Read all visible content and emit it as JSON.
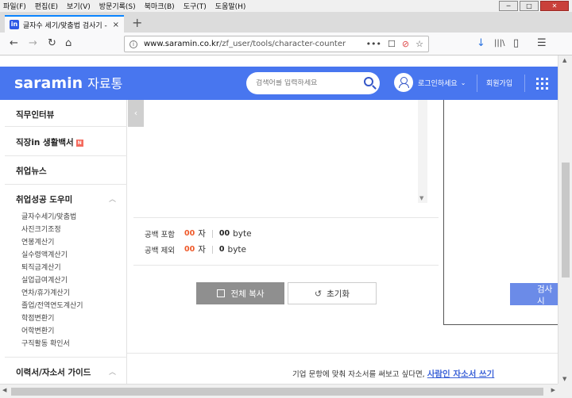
{
  "menu": [
    "파일(F)",
    "편집(E)",
    "보기(V)",
    "방문기록(S)",
    "북마크(B)",
    "도구(T)",
    "도움말(H)"
  ],
  "window_controls": {
    "minimize": "─",
    "maximize": "□",
    "close": "✕"
  },
  "tab": {
    "title": "글자수 세기/맞춤법 검사기 -",
    "close": "×",
    "favicon": "in"
  },
  "newtab": "+",
  "nav": {
    "back": "←",
    "forward": "→",
    "reload": "↻",
    "home": "⌂"
  },
  "url": {
    "host": "www.saramin.co.kr",
    "path": "/zf_user/tools/character-counter"
  },
  "url_tools": [
    "•••",
    "☐",
    "⊘",
    "☆"
  ],
  "toolbar_right": [
    "↓",
    "|||\\",
    "▯",
    "☰"
  ],
  "header": {
    "logo": "saramin",
    "logo_sub": "자료통",
    "search_placeholder": "검색어를 입력하세요",
    "login": "로그인하세요",
    "login_caret": "⌄",
    "signup": "회원가입"
  },
  "sidebar": {
    "items": [
      "직무인터뷰",
      "직장in 생활백서",
      "취업뉴스",
      "취업성공 도우미"
    ],
    "new_badge": "N",
    "chevron_up": "︿",
    "sub_items": [
      "글자수세기/맞춤법",
      "사진크기조정",
      "연봉계산기",
      "실수령액계산기",
      "퇴직금계산기",
      "실업급여계산기",
      "연차/휴가계산기",
      "졸업/전역연도계산기",
      "학점변환기",
      "어학변환기",
      "구직활동 확인서"
    ],
    "bottom_item": "이력서/자소서 가이드"
  },
  "collapse_arrow": "‹",
  "scroll_arrow": "▼",
  "counter": {
    "with_space_label": "공백 포함",
    "without_space_label": "공백 제외",
    "with_space_chars": "00",
    "without_space_chars": "00",
    "char_unit": "자",
    "with_space_bytes": "00",
    "without_space_bytes": "0",
    "byte_unit": "byte"
  },
  "buttons": {
    "copy": "전체 복사",
    "reset": "초기화",
    "reset_icon": "↺",
    "check": "검사 시"
  },
  "promo": {
    "text": "기업 문항에 맞춰 자소서를 써보고 싶다면,",
    "link": "사람인 자소서 쓰기"
  }
}
